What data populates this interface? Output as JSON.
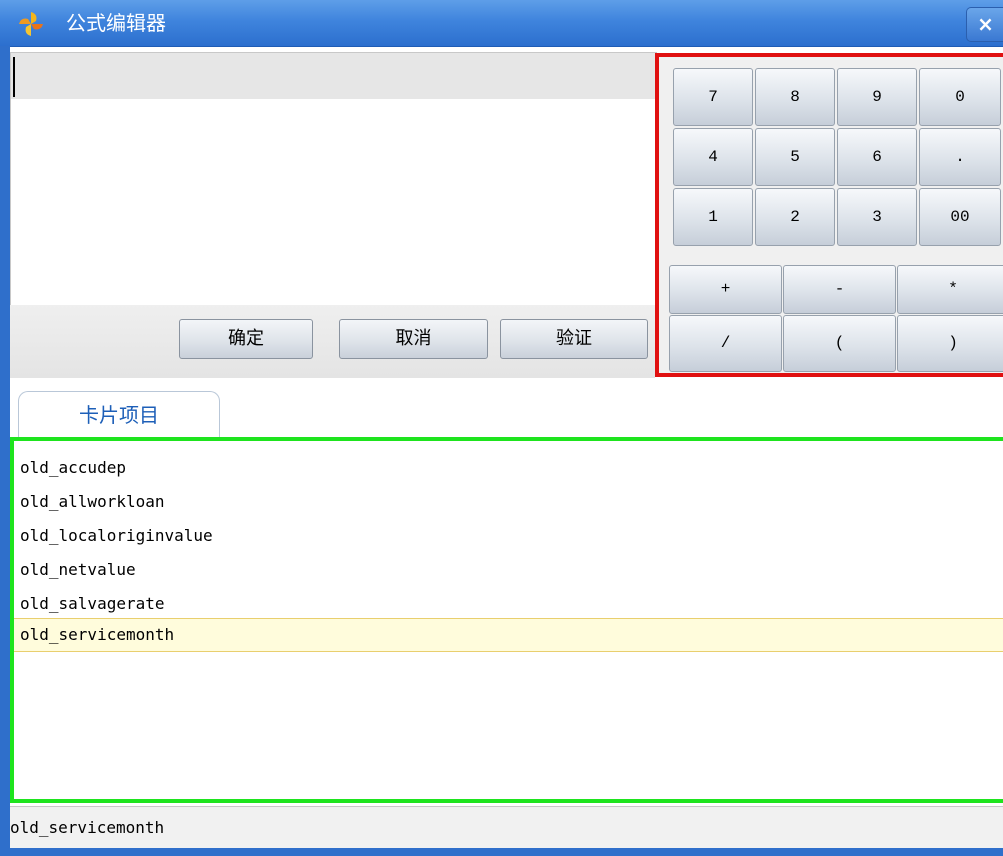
{
  "window": {
    "title": "公式编辑器",
    "close_label": "×",
    "icon": "pinwheel-app-icon"
  },
  "formula": {
    "value": ""
  },
  "actions": {
    "confirm": "确定",
    "cancel": "取消",
    "validate": "验证"
  },
  "keypad": {
    "digits": [
      "7",
      "8",
      "9",
      "0",
      "4",
      "5",
      "6",
      ".",
      "1",
      "2",
      "3",
      "00"
    ],
    "operators": [
      "+",
      "-",
      "*",
      "/",
      "(",
      ")"
    ]
  },
  "tabs": {
    "card_items": "卡片项目"
  },
  "list": {
    "items": [
      "old_accudep",
      "old_allworkloan",
      "old_localoriginvalue",
      "old_netvalue",
      "old_salvagerate",
      "old_servicemonth"
    ],
    "selected_index": 5
  },
  "status": {
    "text": "old_servicemonth"
  },
  "colors": {
    "titlebar": "#3f84dd",
    "keypad_border": "#e01010",
    "list_border": "#1ee41e",
    "selection": "#fffcdc"
  }
}
